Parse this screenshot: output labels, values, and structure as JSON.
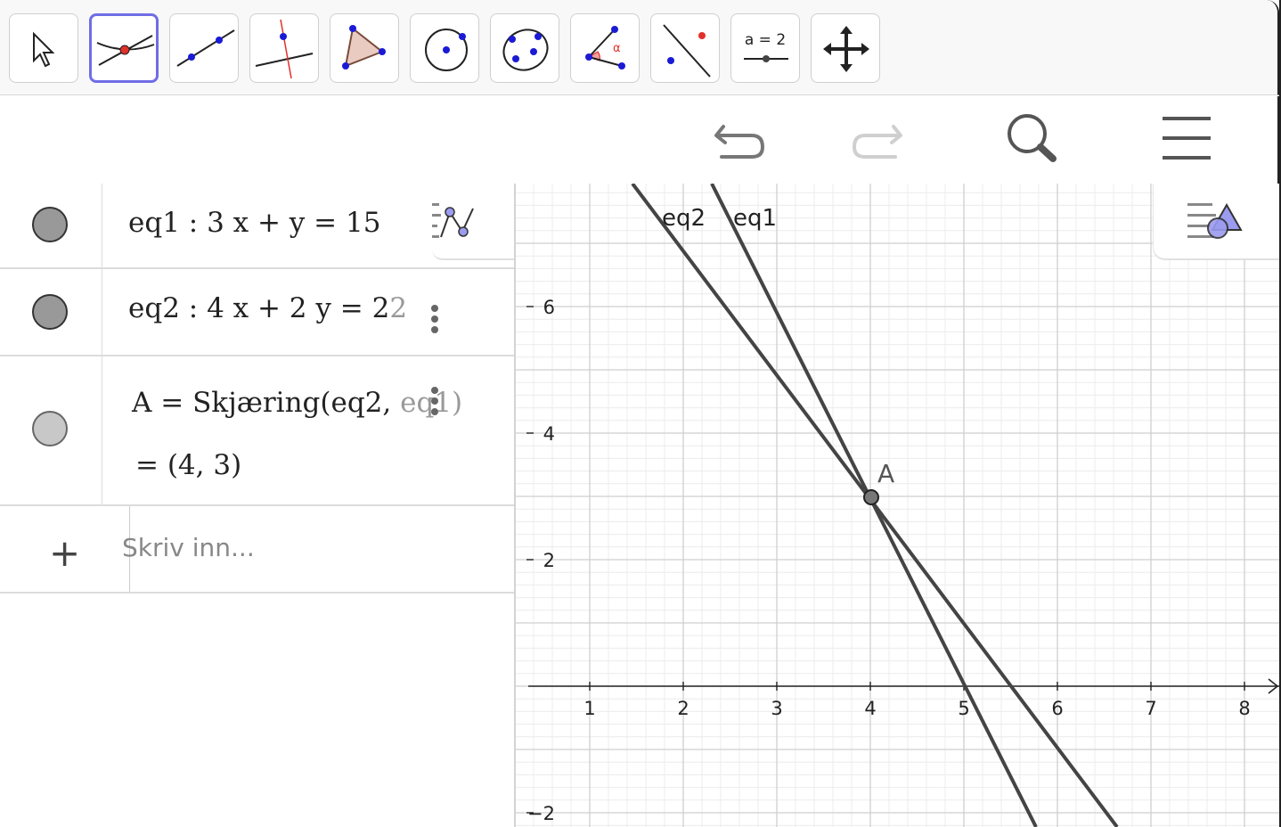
{
  "toolbar": {
    "tools": [
      {
        "name": "move-tool"
      },
      {
        "name": "intersect-tool",
        "selected": true
      },
      {
        "name": "line-tool"
      },
      {
        "name": "perpendicular-line-tool"
      },
      {
        "name": "polygon-tool"
      },
      {
        "name": "circle-center-point-tool"
      },
      {
        "name": "conic-five-points-tool"
      },
      {
        "name": "angle-tool"
      },
      {
        "name": "reflect-about-line-tool"
      },
      {
        "name": "slider-tool",
        "label": "a = 2"
      },
      {
        "name": "move-graphics-view-tool"
      }
    ]
  },
  "header": {
    "undo_icon": "undo-icon",
    "redo_icon": "redo-icon",
    "search_icon": "search-icon",
    "menu_icon": "menu-icon"
  },
  "algebra": {
    "rows": [
      {
        "id": "eq1",
        "expr": "eq1 :  3 x + y  =  15",
        "marker_color": "#999999"
      },
      {
        "id": "eq2",
        "expr_main": "eq2 :  4 x + 2 y  =  2",
        "expr_faint": "2",
        "marker_color": "#999999"
      },
      {
        "id": "A",
        "expr_main": "A  =  Skjæring(eq2, ",
        "expr_faint": "eq1)",
        "value": "=   (4, 3)",
        "marker_color": "#c8c8c8"
      }
    ],
    "input": {
      "plus": "+",
      "placeholder": "Skriv inn..."
    }
  },
  "graphics": {
    "x_ticks": [
      "1",
      "2",
      "3",
      "4",
      "5",
      "6",
      "7",
      "8"
    ],
    "y_ticks": [
      "6",
      "4",
      "2",
      "−2"
    ],
    "labels": {
      "eq1": "eq1",
      "eq2": "eq2",
      "point": "A"
    },
    "line_color": "#444444",
    "grid_major": "#cfcfcf",
    "grid_minor": "#ececec"
  }
}
